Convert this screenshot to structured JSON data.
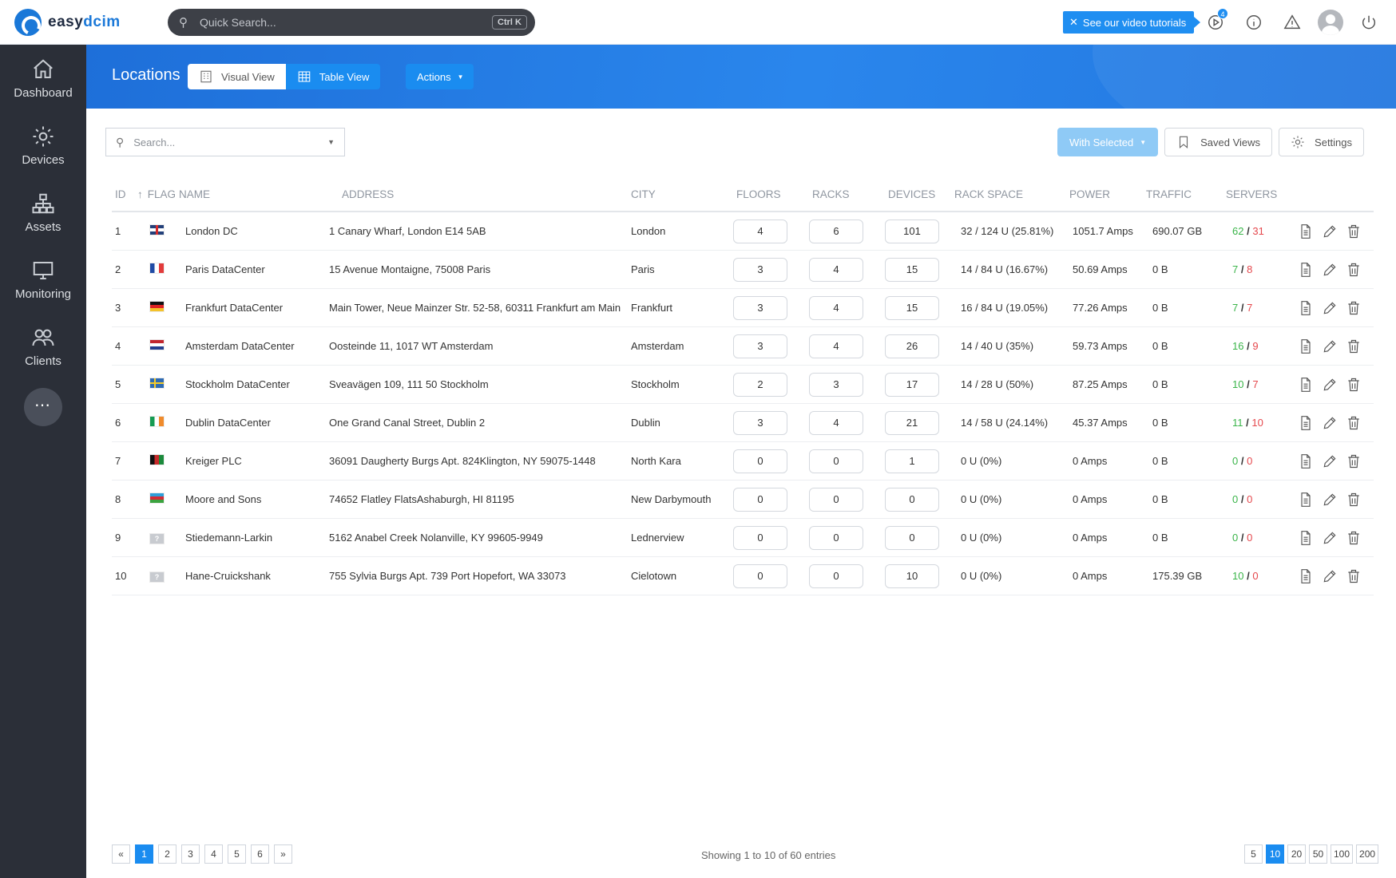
{
  "app": {
    "brand_prefix": "easy",
    "brand_suffix": "dcim"
  },
  "topbar": {
    "quick_search_placeholder": "Quick Search...",
    "quick_search_shortcut": "Ctrl K",
    "tutorials_label": "See our video tutorials",
    "notifications_count": "4",
    "accent": "#1f8ef1"
  },
  "sidebar": {
    "items": [
      {
        "label": "Dashboard",
        "icon": "home-icon"
      },
      {
        "label": "Devices",
        "icon": "gear-icon"
      },
      {
        "label": "Assets",
        "icon": "sitemap-icon"
      },
      {
        "label": "Monitoring",
        "icon": "monitor-icon"
      },
      {
        "label": "Clients",
        "icon": "users-icon"
      }
    ],
    "more_label": "⋯"
  },
  "header": {
    "title": "Locations",
    "visual_view_label": "Visual View",
    "table_view_label": "Table View",
    "actions_label": "Actions"
  },
  "toolbar": {
    "search_placeholder": "Search...",
    "with_selected_label": "With Selected",
    "saved_views_label": "Saved Views",
    "settings_label": "Settings"
  },
  "table": {
    "columns": {
      "id": "ID",
      "sort_indicator": "↑",
      "flag": "FLAG",
      "name": "NAME",
      "address": "ADDRESS",
      "city": "CITY",
      "floors": "FLOORS",
      "racks": "RACKS",
      "devices": "DEVICES",
      "rack_space": "RACK SPACE",
      "power": "POWER",
      "traffic": "TRAFFIC",
      "servers": "SERVERS"
    },
    "server_separator": "/",
    "rows": [
      {
        "id": "1",
        "flag": "gb",
        "name": "London DC",
        "address": "1 Canary Wharf, London E14 5AB",
        "city": "London",
        "floors": "4",
        "racks": "6",
        "devices": "101",
        "rack_space": "32 / 124 U (25.81%)",
        "power": "1051.7 Amps",
        "traffic": "690.07 GB",
        "servers_ok": "62",
        "servers_bad": "31"
      },
      {
        "id": "2",
        "flag": "fr",
        "name": "Paris DataCenter",
        "address": "15 Avenue Montaigne, 75008 Paris",
        "city": "Paris",
        "floors": "3",
        "racks": "4",
        "devices": "15",
        "rack_space": "14 / 84 U (16.67%)",
        "power": "50.69 Amps",
        "traffic": "0 B",
        "servers_ok": "7",
        "servers_bad": "8"
      },
      {
        "id": "3",
        "flag": "de",
        "name": "Frankfurt DataCenter",
        "address": "Main Tower, Neue Mainzer Str. 52-58, 60311 Frankfurt am Main",
        "city": "Frankfurt",
        "floors": "3",
        "racks": "4",
        "devices": "15",
        "rack_space": "16 / 84 U (19.05%)",
        "power": "77.26 Amps",
        "traffic": "0 B",
        "servers_ok": "7",
        "servers_bad": "7"
      },
      {
        "id": "4",
        "flag": "nl",
        "name": "Amsterdam DataCenter",
        "address": "Oosteinde 11, 1017 WT Amsterdam",
        "city": "Amsterdam",
        "floors": "3",
        "racks": "4",
        "devices": "26",
        "rack_space": "14 / 40 U (35%)",
        "power": "59.73 Amps",
        "traffic": "0 B",
        "servers_ok": "16",
        "servers_bad": "9"
      },
      {
        "id": "5",
        "flag": "se",
        "name": "Stockholm DataCenter",
        "address": "Sveavägen 109, 111 50 Stockholm",
        "city": "Stockholm",
        "floors": "2",
        "racks": "3",
        "devices": "17",
        "rack_space": "14 / 28 U (50%)",
        "power": "87.25 Amps",
        "traffic": "0 B",
        "servers_ok": "10",
        "servers_bad": "7"
      },
      {
        "id": "6",
        "flag": "ie",
        "name": "Dublin DataCenter",
        "address": "One Grand Canal Street, Dublin 2",
        "city": "Dublin",
        "floors": "3",
        "racks": "4",
        "devices": "21",
        "rack_space": "14 / 58 U (24.14%)",
        "power": "45.37 Amps",
        "traffic": "0 B",
        "servers_ok": "11",
        "servers_bad": "10"
      },
      {
        "id": "7",
        "flag": "af",
        "name": "Kreiger PLC",
        "address": "36091 Daugherty Burgs Apt. 824Klington, NY 59075-1448",
        "city": "North Kara",
        "floors": "0",
        "racks": "0",
        "devices": "1",
        "rack_space": "0 U (0%)",
        "power": "0 Amps",
        "traffic": "0 B",
        "servers_ok": "0",
        "servers_bad": "0"
      },
      {
        "id": "8",
        "flag": "az",
        "name": "Moore and Sons",
        "address": "74652 Flatley FlatsAshaburgh, HI 81195",
        "city": "New Darbymouth",
        "floors": "0",
        "racks": "0",
        "devices": "0",
        "rack_space": "0 U (0%)",
        "power": "0 Amps",
        "traffic": "0 B",
        "servers_ok": "0",
        "servers_bad": "0"
      },
      {
        "id": "9",
        "flag": "unknown",
        "name": "Stiedemann-Larkin",
        "address": "5162 Anabel Creek Nolanville, KY 99605-9949",
        "city": "Lednerview",
        "floors": "0",
        "racks": "0",
        "devices": "0",
        "rack_space": "0 U (0%)",
        "power": "0 Amps",
        "traffic": "0 B",
        "servers_ok": "0",
        "servers_bad": "0"
      },
      {
        "id": "10",
        "flag": "unknown",
        "name": "Hane-Cruickshank",
        "address": "755 Sylvia Burgs Apt. 739 Port Hopefort, WA 33073",
        "city": "Cielotown",
        "floors": "0",
        "racks": "0",
        "devices": "10",
        "rack_space": "0 U (0%)",
        "power": "0 Amps",
        "traffic": "175.39 GB",
        "servers_ok": "10",
        "servers_bad": "0"
      }
    ]
  },
  "footer": {
    "prev_label": "«",
    "next_label": "»",
    "pages": [
      "1",
      "2",
      "3",
      "4",
      "5",
      "6"
    ],
    "current_page": "1",
    "showing_text": "Showing 1 to 10 of 60 entries",
    "page_sizes": [
      "5",
      "10",
      "20",
      "50",
      "100",
      "200"
    ],
    "current_page_size": "10"
  },
  "colors": {
    "sidebar_bg": "#2b2f38",
    "header_blue": "#2377e0",
    "ok_green": "#3bb54a",
    "bad_red": "#e5484d"
  }
}
